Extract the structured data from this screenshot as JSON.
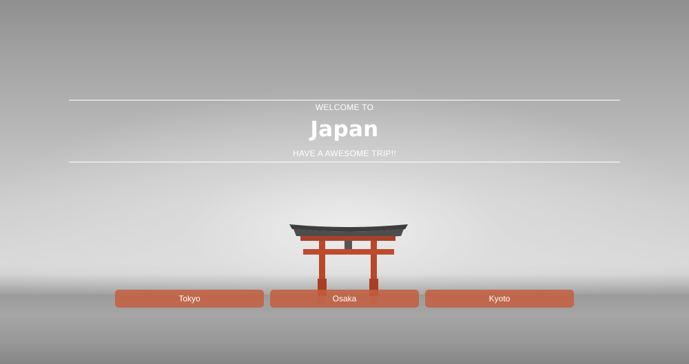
{
  "hero": {
    "welcome_text": "WELCOME TO",
    "title": "Japan",
    "subtitle": "HAVE A AWESOME TRIP!!"
  },
  "buttons": [
    {
      "label": "Tokyo"
    },
    {
      "label": "Osaka"
    },
    {
      "label": "Kyoto"
    }
  ],
  "colors": {
    "button_bg": "#c45e3e",
    "torii_red": "#b8482a",
    "torii_roof": "#4a4a4a",
    "text": "#ffffff"
  }
}
